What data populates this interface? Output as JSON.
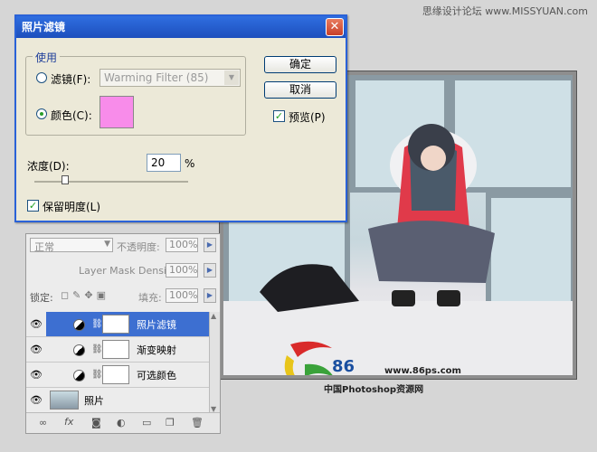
{
  "watermark": "思缘设计论坛 www.MISSYUAN.com",
  "dialog": {
    "title": "照片滤镜",
    "close_glyph": "✕",
    "group_label": "使用",
    "filter_label": "滤镜(F):",
    "filter_value": "Warming Filter (85)",
    "color_label": "颜色(C):",
    "swatch_color": "#f88cea",
    "density_label": "浓度(D):",
    "density_value": "20",
    "density_unit": "%",
    "density_fraction": 0.2,
    "preserve_label": "保留明度(L)",
    "ok_label": "确定",
    "cancel_label": "取消",
    "preview_label": "预览(P)",
    "check_mark": "✓"
  },
  "layers_panel": {
    "blend_mode": "正常",
    "opacity_label": "不透明度:",
    "opacity_value": "100%",
    "mask_density_label": "Layer Mask Density",
    "mask_density_value": "100%",
    "lock_label": "锁定:",
    "fill_label": "填充:",
    "fill_value": "100%",
    "layers": [
      {
        "name": "照片滤镜",
        "selected": true
      },
      {
        "name": "渐变映射",
        "selected": false
      },
      {
        "name": "可选颜色",
        "selected": false
      },
      {
        "name": "照片",
        "selected": false
      }
    ],
    "eye_glyph": "👁"
  },
  "logo": {
    "brand_number": "86",
    "url": "www.86ps.com",
    "caption": "中国Photoshop资源网"
  },
  "colors": {
    "accent": "#3d6fd1",
    "titlebar": "#2f6ee0"
  }
}
